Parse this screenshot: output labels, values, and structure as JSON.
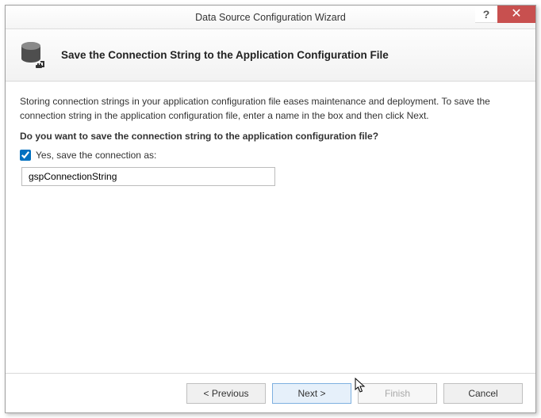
{
  "window": {
    "title": "Data Source Configuration Wizard",
    "help_symbol": "?",
    "close_symbol": "✕"
  },
  "header": {
    "title": "Save the Connection String to the Application Configuration File"
  },
  "body": {
    "description": "Storing connection strings in your application configuration file eases maintenance and deployment. To save the connection string in the application configuration file, enter a name in the box and then click Next.",
    "prompt": "Do you want to save the connection string to the application configuration file?",
    "checkbox_label": "Yes, save the connection as:",
    "checkbox_checked": true,
    "connection_name": "gspConnectionString"
  },
  "footer": {
    "previous": "< Previous",
    "next": "Next >",
    "finish": "Finish",
    "cancel": "Cancel"
  }
}
